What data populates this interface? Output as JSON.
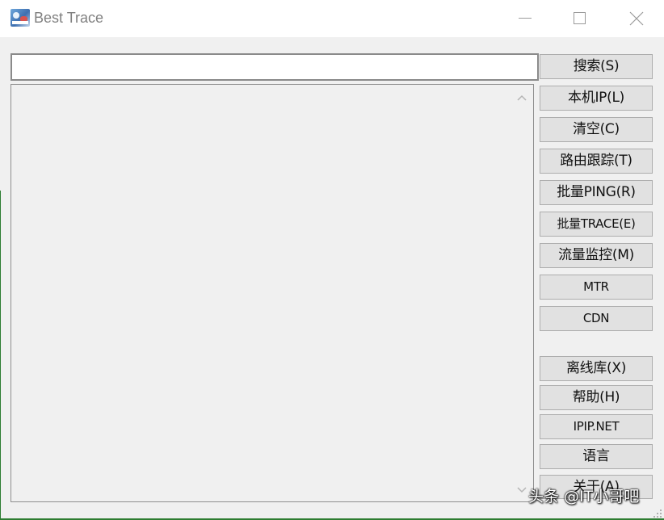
{
  "window": {
    "title": "Best Trace",
    "icon": "best-trace-app-icon",
    "controls": {
      "minimize_icon": "minimize-icon",
      "maximize_icon": "maximize-icon",
      "close_icon": "close-icon"
    }
  },
  "search": {
    "value": "",
    "placeholder": ""
  },
  "result_area": {
    "text": "",
    "scroll_up_icon": "chevron-up-icon",
    "scroll_down_icon": "chevron-down-icon"
  },
  "buttons": {
    "search": "搜索(S)",
    "local_ip": "本机IP(L)",
    "clear": "清空(C)",
    "traceroute": "路由跟踪(T)",
    "batch_ping": "批量PING(R)",
    "batch_trace": "批量TRACE(E)",
    "traffic_monitor": "流量监控(M)",
    "mtr": "MTR",
    "cdn": "CDN",
    "offline_db": "离线库(X)",
    "help": "帮助(H)",
    "ipip_net": "IPIP.NET",
    "language": "语言",
    "about": "关于(A)"
  },
  "watermark": {
    "text": "头条 @IT小哥吧"
  },
  "colors": {
    "window_bg": "#f0f0f0",
    "titlebar_bg": "#ffffff",
    "button_bg": "#e1e1e1",
    "button_border": "#adadad",
    "title_text": "#808080"
  }
}
